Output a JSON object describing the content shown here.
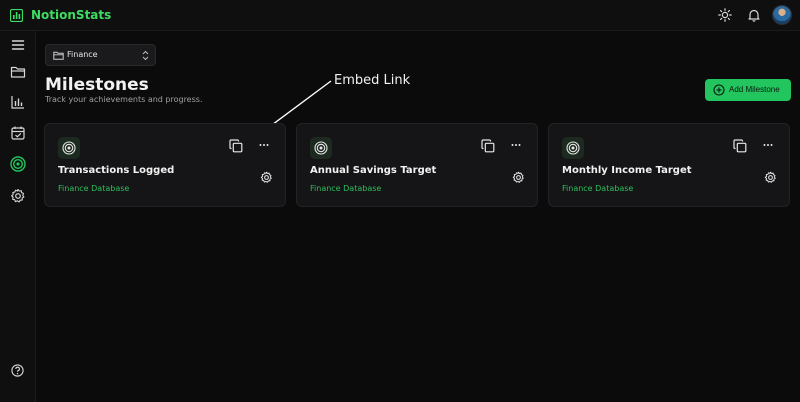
{
  "app": {
    "name": "NotionStats"
  },
  "toolbar": {
    "icons": [
      "sun-icon",
      "bell-icon"
    ],
    "avatar": "user-avatar"
  },
  "sidebar": {
    "items": [
      {
        "name": "menu-icon"
      },
      {
        "name": "folder-icon"
      },
      {
        "name": "bar-chart-icon"
      },
      {
        "name": "calendar-check-icon"
      },
      {
        "name": "target-icon",
        "active": true
      },
      {
        "name": "gear-icon"
      }
    ],
    "bottom": "help-icon"
  },
  "workspace": {
    "selected": "Finance"
  },
  "page": {
    "title": "Milestones",
    "subtitle": "Track your achievements and progress.",
    "add_button": "Add Milestone"
  },
  "annotation": {
    "label": "Embed Link"
  },
  "cards": [
    {
      "title": "Transactions Logged",
      "database": "Finance Database"
    },
    {
      "title": "Annual Savings Target",
      "database": "Finance Database"
    },
    {
      "title": "Monthly Income Target",
      "database": "Finance Database"
    }
  ],
  "colors": {
    "accent": "#22c55e",
    "link": "#2fbe5c",
    "background": "#0b0b0c",
    "card": "#151517"
  }
}
